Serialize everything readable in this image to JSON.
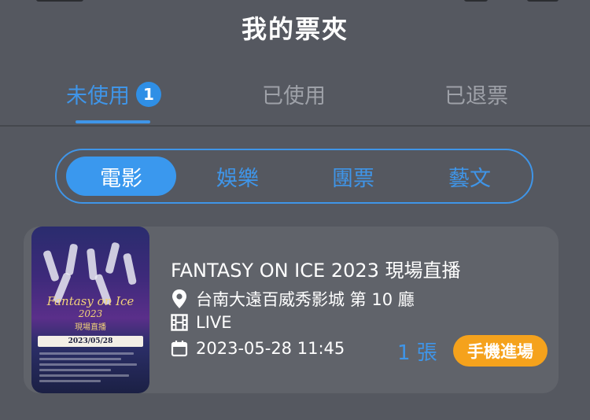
{
  "header": {
    "title": "我的票夾"
  },
  "tabs": [
    {
      "label": "未使用",
      "badge": "1"
    },
    {
      "label": "已使用"
    },
    {
      "label": "已退票"
    }
  ],
  "categories": [
    {
      "label": "電影"
    },
    {
      "label": "娛樂"
    },
    {
      "label": "團票"
    },
    {
      "label": "藝文"
    }
  ],
  "ticket": {
    "title": "FANTASY ON ICE 2023 現場直播",
    "venue": "台南大遠百威秀影城 第 10 廳",
    "format": "LIVE",
    "datetime": "2023-05-28 11:45",
    "count": "1 張",
    "entry_button": "手機進場",
    "poster": {
      "line1": "Fantasy on Ice",
      "line2": "2023",
      "line3": "現場直播",
      "date": "2023/05/28"
    }
  },
  "colors": {
    "background": "#555860",
    "accent": "#3f95e8",
    "card": "#60636a",
    "button": "#f5a21c"
  },
  "icons": {
    "venue": "location-pin-icon",
    "format": "film-icon",
    "datetime": "calendar-icon"
  }
}
